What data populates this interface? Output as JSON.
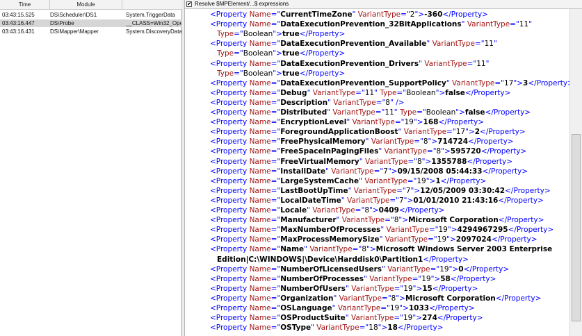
{
  "grid": {
    "headers": [
      "Time",
      "Module"
    ],
    "rows": [
      {
        "time": "03:43:15.525",
        "module": "DS\\Scheduler\\DS1",
        "data": "System.TriggerData",
        "selected": false
      },
      {
        "time": "03:43:16.447",
        "module": "DS\\Probe",
        "data": "__CLASS=Win32_Oper",
        "selected": true
      },
      {
        "time": "03:43:16.431",
        "module": "DS\\Mapper\\Mapper",
        "data": "System.DiscoveryData",
        "selected": false
      }
    ]
  },
  "resolve": {
    "checked": true,
    "label": "Resolve $MPElement/...$ expressions"
  },
  "xml": {
    "lines": [
      {
        "indent": 36,
        "name": "CurrentTimeZone",
        "vt": "2",
        "value": "-360"
      },
      {
        "indent": 36,
        "name": "DataExecutionPrevention_32BitApplications",
        "vt": "11"
      },
      {
        "indent": 46,
        "cont_type": "Boolean",
        "value": "true"
      },
      {
        "indent": 36,
        "name": "DataExecutionPrevention_Available",
        "vt": "11"
      },
      {
        "indent": 46,
        "cont_type": "Boolean",
        "value": "true"
      },
      {
        "indent": 36,
        "name": "DataExecutionPrevention_Drivers",
        "vt": "11"
      },
      {
        "indent": 46,
        "cont_type": "Boolean",
        "value": "true"
      },
      {
        "indent": 36,
        "name": "DataExecutionPrevention_SupportPolicy",
        "vt": "17",
        "value": "3"
      },
      {
        "indent": 36,
        "name": "Debug",
        "vt": "11",
        "type": "Boolean",
        "value": "false"
      },
      {
        "indent": 36,
        "name": "Description",
        "vt": "8",
        "selfclose": true
      },
      {
        "indent": 36,
        "name": "Distributed",
        "vt": "11",
        "type": "Boolean",
        "value": "false"
      },
      {
        "indent": 36,
        "name": "EncryptionLevel",
        "vt": "19",
        "value": "168"
      },
      {
        "indent": 36,
        "name": "ForegroundApplicationBoost",
        "vt": "17",
        "value": "2"
      },
      {
        "indent": 36,
        "name": "FreePhysicalMemory",
        "vt": "8",
        "value": "714724"
      },
      {
        "indent": 36,
        "name": "FreeSpaceInPagingFiles",
        "vt": "8",
        "value": "595720"
      },
      {
        "indent": 36,
        "name": "FreeVirtualMemory",
        "vt": "8",
        "value": "1355788"
      },
      {
        "indent": 36,
        "name": "InstallDate",
        "vt": "7",
        "value": "09/15/2008 05:44:33"
      },
      {
        "indent": 36,
        "name": "LargeSystemCache",
        "vt": "19",
        "value": "1"
      },
      {
        "indent": 36,
        "name": "LastBootUpTime",
        "vt": "7",
        "value": "12/05/2009 03:30:42"
      },
      {
        "indent": 36,
        "name": "LocalDateTime",
        "vt": "7",
        "value": "01/01/2010 21:43:16"
      },
      {
        "indent": 36,
        "name": "Locale",
        "vt": "8",
        "value": "0409"
      },
      {
        "indent": 36,
        "name": "Manufacturer",
        "vt": "8",
        "value": "Microsoft Corporation"
      },
      {
        "indent": 36,
        "name": "MaxNumberOfProcesses",
        "vt": "19",
        "value": "4294967295"
      },
      {
        "indent": 36,
        "name": "MaxProcessMemorySize",
        "vt": "19",
        "value": "2097024"
      },
      {
        "indent": 36,
        "name": "Name",
        "vt": "8",
        "open_value": "Microsoft Windows Server 2003 Enterprise"
      },
      {
        "indent": 46,
        "tail_value": "Edition|C:\\WINDOWS|\\Device\\Harddisk0\\Partition1"
      },
      {
        "indent": 36,
        "name": "NumberOfLicensedUsers",
        "vt": "19",
        "value": "0"
      },
      {
        "indent": 36,
        "name": "NumberOfProcesses",
        "vt": "19",
        "value": "58"
      },
      {
        "indent": 36,
        "name": "NumberOfUsers",
        "vt": "19",
        "value": "15"
      },
      {
        "indent": 36,
        "name": "Organization",
        "vt": "8",
        "value": "Microsoft Corporation"
      },
      {
        "indent": 36,
        "name": "OSLanguage",
        "vt": "19",
        "value": "1033"
      },
      {
        "indent": 36,
        "name": "OSProductSuite",
        "vt": "19",
        "value": "274"
      },
      {
        "indent": 36,
        "name": "OSType",
        "vt": "18",
        "value": "18"
      }
    ]
  },
  "colors": {
    "tag": "#0000ff",
    "attr_name": "#a31515",
    "selected_row": "#d6d6d6"
  }
}
